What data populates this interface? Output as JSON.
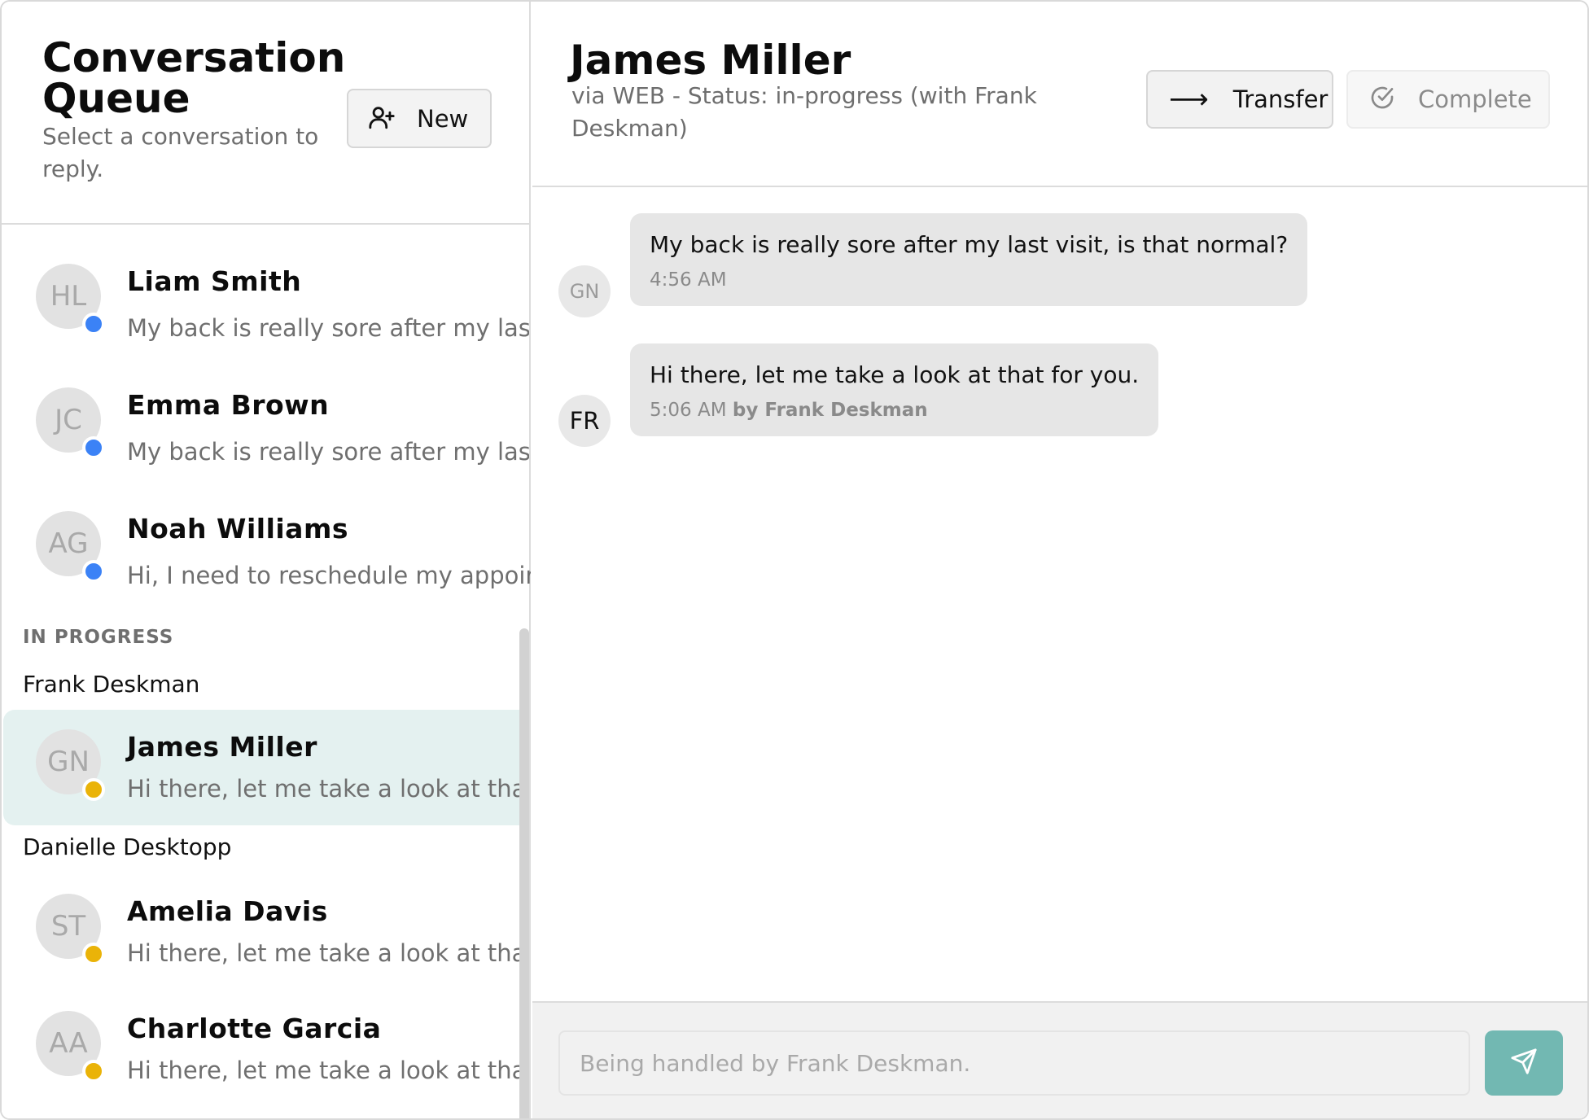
{
  "queue": {
    "title": "Conversation Queue",
    "subtitle": "Select a conversation to reply.",
    "new_button_label": "New",
    "waiting": [
      {
        "initials": "HL",
        "name": "Liam Smith",
        "preview": "My back is really sore after my last visit, is that normal?",
        "status": "blue"
      },
      {
        "initials": "JC",
        "name": "Emma Brown",
        "preview": "My back is really sore after my last visit, is that normal?",
        "status": "blue"
      },
      {
        "initials": "AG",
        "name": "Noah Williams",
        "preview": "Hi, I need to reschedule my appointment",
        "status": "blue"
      }
    ],
    "in_progress_label": "IN PROGRESS",
    "agents": [
      {
        "name": "Frank Deskman",
        "items": [
          {
            "initials": "GN",
            "name": "James Miller",
            "preview": "Hi there, let me take a look at that for you.",
            "status": "yellow",
            "active": true
          }
        ]
      },
      {
        "name": "Danielle Desktopp",
        "items": [
          {
            "initials": "ST",
            "name": "Amelia Davis",
            "preview": "Hi there, let me take a look at that for you.",
            "status": "yellow"
          },
          {
            "initials": "AA",
            "name": "Charlotte Garcia",
            "preview": "Hi there, let me take a look at that for you.",
            "status": "yellow"
          }
        ]
      }
    ]
  },
  "chat": {
    "title": "James Miller",
    "subtitle": "via WEB - Status: in-progress (with Frank Deskman)",
    "transfer_label": "Transfer",
    "complete_label": "Complete",
    "messages": [
      {
        "initials": "GN",
        "text": "My back is really sore after my last visit, is that normal?",
        "time": "4:56 AM",
        "by": ""
      },
      {
        "initials": "FR",
        "text": "Hi there, let me take a look at that for you.",
        "time": "5:06 AM",
        "by": "by Frank Deskman"
      }
    ],
    "composer_placeholder": "Being handled by Frank Deskman."
  },
  "colors": {
    "accent": "#72b8b2",
    "active_row": "#e4f1f0",
    "status_blue": "#3b82f6",
    "status_yellow": "#eab308"
  }
}
